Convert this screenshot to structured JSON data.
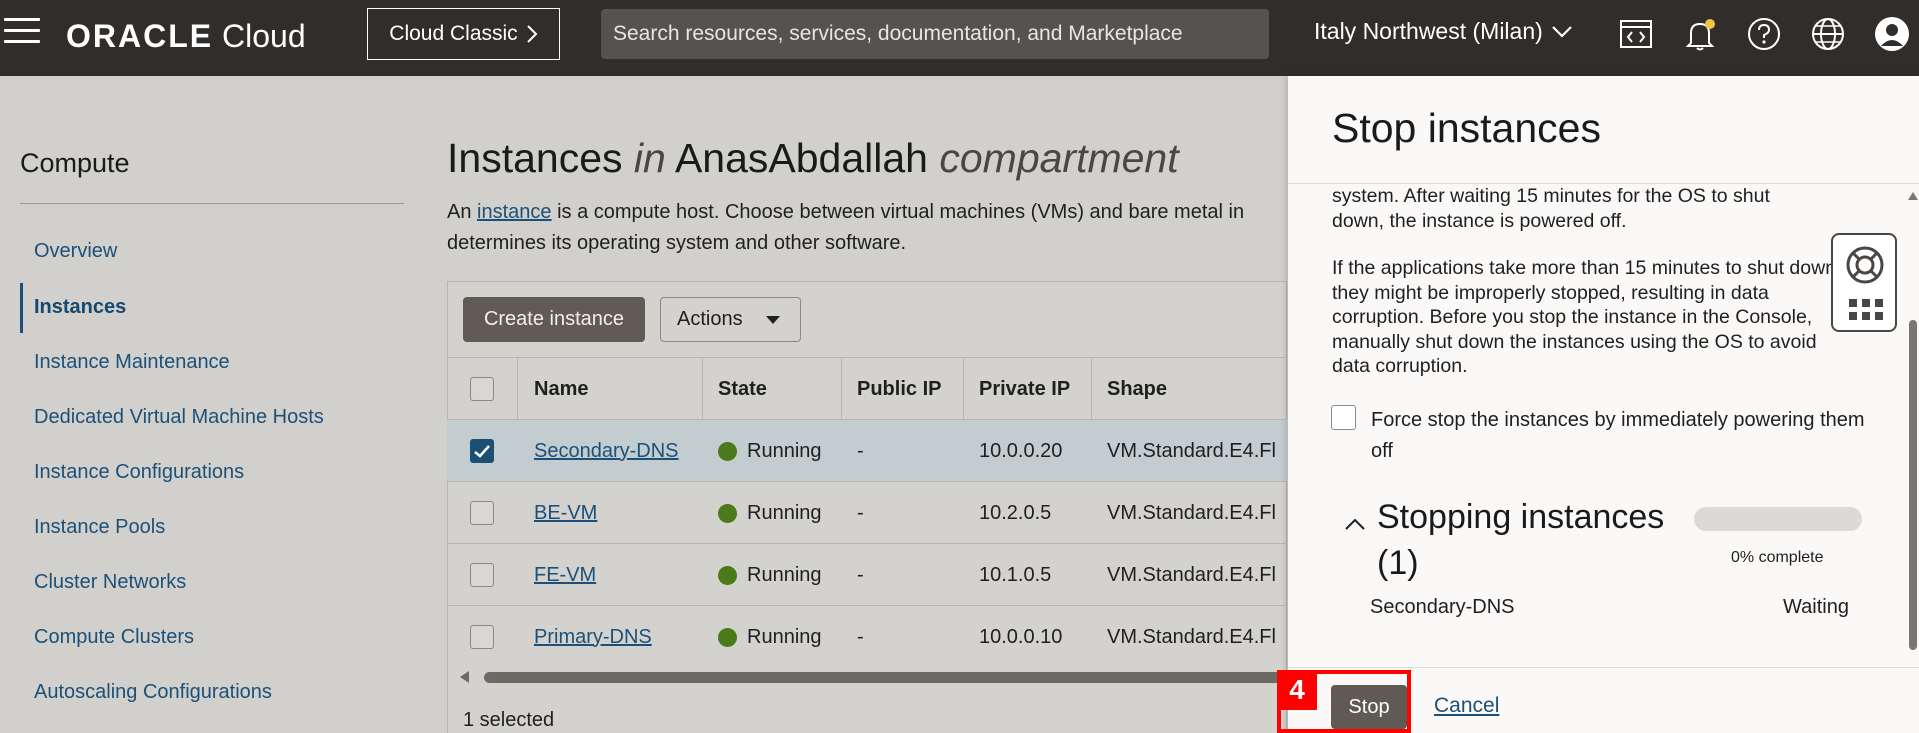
{
  "header": {
    "brand_strong": "ORACLE",
    "brand_light": " Cloud",
    "classic_label": "Cloud Classic",
    "search_placeholder": "Search resources, services, documentation, and Marketplace",
    "region": "Italy Northwest (Milan)"
  },
  "sidebar": {
    "title": "Compute",
    "items": [
      {
        "label": "Overview"
      },
      {
        "label": "Instances"
      },
      {
        "label": "Instance Maintenance"
      },
      {
        "label": "Dedicated Virtual Machine Hosts"
      },
      {
        "label": "Instance Configurations"
      },
      {
        "label": "Instance Pools"
      },
      {
        "label": "Cluster Networks"
      },
      {
        "label": "Compute Clusters"
      },
      {
        "label": "Autoscaling Configurations"
      }
    ]
  },
  "main": {
    "title_part1": "Instances ",
    "title_in": "in",
    "title_part2": " AnasAbdallah ",
    "title_compartment": "compartment",
    "desc_prefix": "An ",
    "desc_link": "instance",
    "desc_rest": " is a compute host. Choose between virtual machines (VMs) and bare metal in",
    "desc_line2": "determines its operating system and other software.",
    "create_label": "Create instance",
    "actions_label": "Actions",
    "selected_count": "1 selected",
    "columns": [
      "Name",
      "State",
      "Public IP",
      "Private IP",
      "Shape"
    ],
    "rows": [
      {
        "name": "Secondary-DNS",
        "state": "Running",
        "public_ip": "-",
        "private_ip": "10.0.0.20",
        "shape": "VM.Standard.E4.Fl",
        "selected": true
      },
      {
        "name": "BE-VM",
        "state": "Running",
        "public_ip": "-",
        "private_ip": "10.2.0.5",
        "shape": "VM.Standard.E4.Fl",
        "selected": false
      },
      {
        "name": "FE-VM",
        "state": "Running",
        "public_ip": "-",
        "private_ip": "10.1.0.5",
        "shape": "VM.Standard.E4.Fl",
        "selected": false
      },
      {
        "name": "Primary-DNS",
        "state": "Running",
        "public_ip": "-",
        "private_ip": "10.0.0.10",
        "shape": "VM.Standard.E4.Fl",
        "selected": false
      }
    ]
  },
  "drawer": {
    "title": "Stop instances",
    "para1_line1": "system. After waiting 15 minutes for the OS to shut",
    "para1_line2": "down, the instance is powered off.",
    "para2": "If the applications take more than 15 minutes to shut down, they might be improperly stopped, resulting in data corruption. Before you stop the instance in the Console, manually shut down the instances using the OS to avoid data corruption.",
    "force_label": "Force stop the instances by immediately powering them off",
    "stopping_title": "Stopping instances (1)",
    "progress_fraction": 0,
    "progress_text": "0% complete",
    "instance_name": "Secondary-DNS",
    "instance_status": "Waiting",
    "stop_label": "Stop",
    "cancel_label": "Cancel"
  },
  "annotation": {
    "step": "4"
  },
  "colors": {
    "header_bg": "#312d2a",
    "link": "#1c5078",
    "running": "#4a7a1a",
    "annotation": "#ff0000"
  }
}
